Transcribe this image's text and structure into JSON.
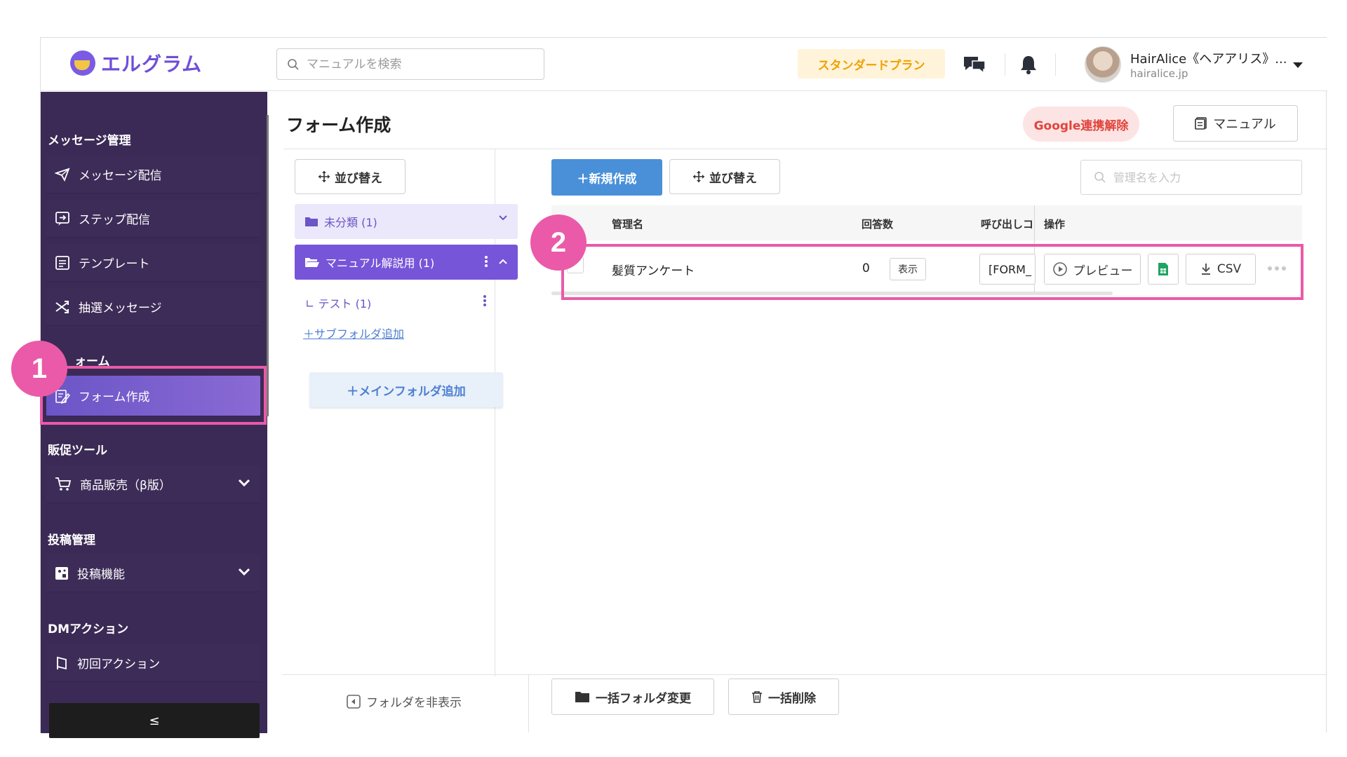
{
  "header": {
    "logo_text": "エルグラム",
    "search_placeholder": "マニュアルを検索",
    "plan_badge": "スタンダードプラン",
    "user_name": "HairAlice《ヘアアリス》...",
    "user_domain": "hairalice.jp",
    "icons": [
      "chat-icon",
      "bell-icon",
      "caret-down-icon"
    ]
  },
  "sidebar": {
    "sections": [
      {
        "title": "メッセージ管理",
        "items": [
          {
            "label": "メッセージ配信",
            "icon": "send-icon"
          },
          {
            "label": "ステップ配信",
            "icon": "step-icon"
          },
          {
            "label": "テンプレート",
            "icon": "template-icon"
          },
          {
            "label": "抽選メッセージ",
            "icon": "shuffle-icon"
          }
        ]
      },
      {
        "title": "ォーム",
        "items": [
          {
            "label": "フォーム作成",
            "icon": "form-edit-icon",
            "active": true
          }
        ]
      },
      {
        "title": "販促ツール",
        "items": [
          {
            "label": "商品販売（β版）",
            "icon": "cart-icon"
          }
        ]
      },
      {
        "title": "投稿管理",
        "items": [
          {
            "label": "投稿機能",
            "icon": "post-icon"
          }
        ]
      },
      {
        "title": "DMアクション",
        "items": [
          {
            "label": "初回アクション",
            "icon": "flag-icon"
          }
        ]
      }
    ],
    "collapse_label": "≤"
  },
  "page": {
    "title": "フォーム作成",
    "google_button": "Google連携解除",
    "manual_button": "マニュアル"
  },
  "folders": {
    "sort_button": "並び替え",
    "unclassified": "未分類 (1)",
    "active_folder": "マニュアル解説用 (1)",
    "sub_folder": "テスト (1)",
    "add_subfolder": "サブフォルダ追加",
    "add_main_folder": "＋メインフォルダ追加",
    "hide_folder": "フォルダを非表示"
  },
  "main": {
    "new_button": "＋新規作成",
    "sort_button": "並び替え",
    "search_placeholder": "管理名を入力",
    "columns": [
      "管理名",
      "回答数",
      "呼び出しコ",
      "操作"
    ],
    "rows": [
      {
        "name": "髪質アンケート",
        "answers": "0",
        "show_button": "表示",
        "code": "[FORM_",
        "preview_button": "プレビュー",
        "csv_button": "CSV"
      }
    ],
    "bulk_folder_button": "一括フォルダ変更",
    "bulk_delete_button": "一括削除"
  },
  "annotations": {
    "marker_1": "1",
    "marker_2": "2",
    "color": "#ea5aa8"
  }
}
